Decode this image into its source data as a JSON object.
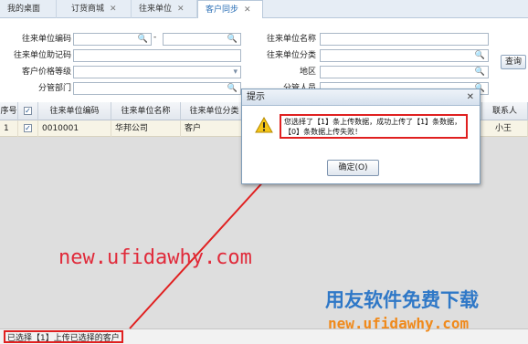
{
  "tabs": [
    {
      "label": "我的桌面",
      "closable": false,
      "active": false
    },
    {
      "label": "订货商城",
      "closable": true,
      "active": false
    },
    {
      "label": "往来单位",
      "closable": true,
      "active": false
    },
    {
      "label": "客户同步",
      "closable": true,
      "active": true
    }
  ],
  "search": {
    "code_label": "往来单位编码",
    "mnemonic_label": "往来单位助记码",
    "price_level_label": "客户价格等级",
    "dept_label": "分管部门",
    "name_label": "往来单位名称",
    "category_label": "往来单位分类",
    "region_label": "地区",
    "staff_label": "分管人员",
    "range_separator": "-",
    "query_button": "查询"
  },
  "grid": {
    "columns": [
      "序号",
      "往来单位编码",
      "往来单位名称",
      "往来单位分类",
      "联系人"
    ],
    "rows": [
      {
        "index": "1",
        "checked": true,
        "code": "0010001",
        "name": "华邦公司",
        "category": "客户",
        "contact": "小王"
      }
    ]
  },
  "status": {
    "text": "已选择【1】上传已选择的客户"
  },
  "dialog": {
    "title": "提示",
    "message_line1": "您选择了【1】条上传数据，成功上传了【1】条数据，",
    "message_line2": "【0】条数据上传失败！",
    "ok_label": "确定(O)"
  },
  "watermark": {
    "url": "new.ufidawhy.com",
    "brand": "用友软件免费下载",
    "url2": "new.ufidawhy.com"
  },
  "colors": {
    "annotation": "#e02020",
    "brand_blue": "#2f78c7",
    "brand_orange": "#f08a1c"
  }
}
